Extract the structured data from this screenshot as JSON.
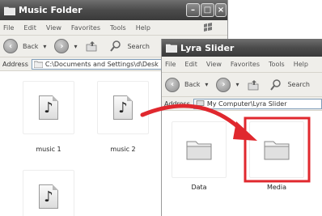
{
  "music_window": {
    "title": "Music Folder",
    "menu": [
      "File",
      "Edit",
      "View",
      "Favorites",
      "Tools",
      "Help"
    ],
    "toolbar": {
      "back_label": "Back",
      "search_label": "Search"
    },
    "address": {
      "label": "Address",
      "path": "C:\\Documents and Settings\\d\\Desk"
    },
    "files": [
      {
        "name": "music 1"
      },
      {
        "name": "music 2"
      },
      {
        "name": ""
      }
    ]
  },
  "lyra_window": {
    "title": "Lyra Slider",
    "menu": [
      "File",
      "Edit",
      "View",
      "Favorites",
      "Tools",
      "Help"
    ],
    "toolbar": {
      "back_label": "Back",
      "search_label": "Search"
    },
    "address": {
      "label": "Address",
      "path": "My Computer\\Lyra Slider"
    },
    "folders": [
      {
        "name": "Data"
      },
      {
        "name": "Media"
      }
    ]
  },
  "colors": {
    "highlight_box": "#e0282e",
    "drag_arrow": "#e0282e",
    "titlebar": "#4b4b4b"
  },
  "icons": {
    "file": "music-note-file-icon",
    "folder": "folder-icon",
    "window": "folder-window-icon"
  }
}
